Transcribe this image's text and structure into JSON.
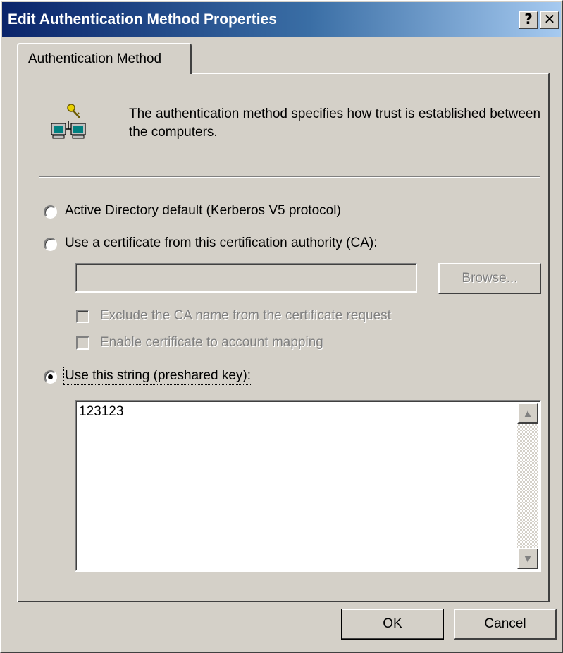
{
  "window": {
    "title": "Edit Authentication Method Properties",
    "help_glyph": "?",
    "close_glyph": "✕"
  },
  "tabs": [
    {
      "label": "Authentication Method",
      "selected": true
    }
  ],
  "header": {
    "icon": "computers-key-icon",
    "description": "The authentication method specifies how trust is established between the computers."
  },
  "options": {
    "kerberos": {
      "label": "Active Directory default (Kerberos V5 protocol)",
      "selected": false
    },
    "certificate": {
      "label": "Use a certificate from this certification authority (CA):",
      "selected": false,
      "ca_value": "",
      "browse_label": "Browse...",
      "exclude_ca_label": "Exclude the CA name from the certificate request",
      "exclude_ca_checked": false,
      "enable_mapping_label": "Enable certificate to account mapping",
      "enable_mapping_checked": false
    },
    "preshared": {
      "label": "Use this string (preshared key):",
      "selected": true,
      "value": "123123"
    }
  },
  "buttons": {
    "ok_label": "OK",
    "cancel_label": "Cancel"
  },
  "colors": {
    "titlebar_start": "#0a246a",
    "titlebar_end": "#a6caf0",
    "face": "#d4d0c8",
    "disabled_text": "#808080"
  }
}
